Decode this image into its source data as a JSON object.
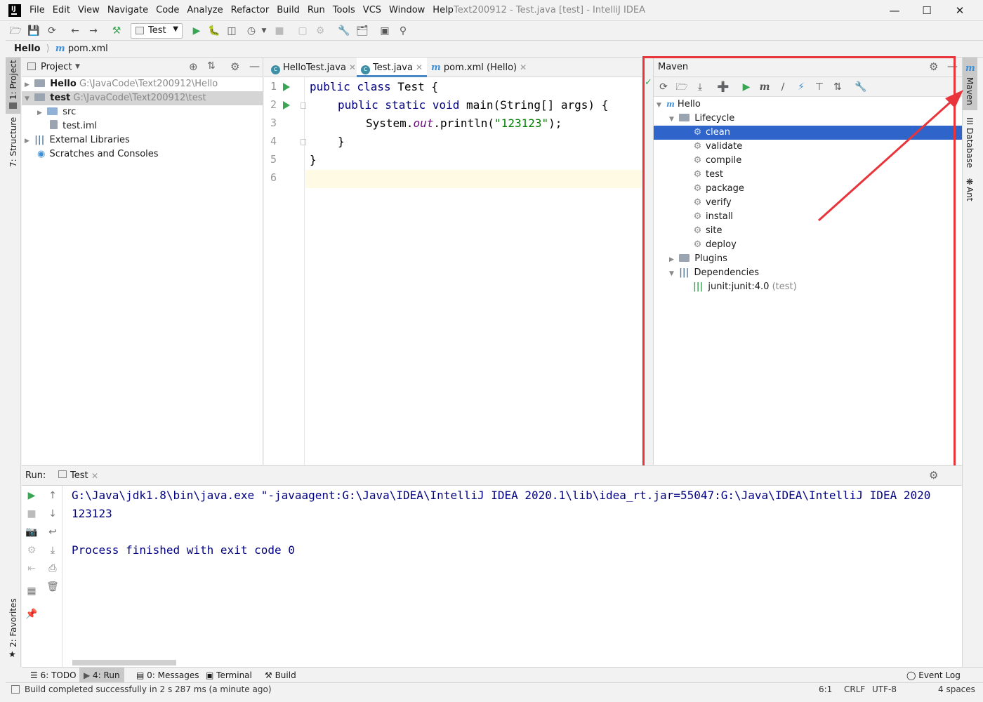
{
  "menu": [
    "File",
    "Edit",
    "View",
    "Navigate",
    "Code",
    "Analyze",
    "Refactor",
    "Build",
    "Run",
    "Tools",
    "VCS",
    "Window",
    "Help"
  ],
  "window_title": "Text200912 - Test.java [test] - IntelliJ IDEA",
  "toolbar": {
    "run_config": "Test"
  },
  "breadcrumb": {
    "project": "Hello",
    "file": "pom.xml"
  },
  "left_stripe": {
    "project": "1: Project",
    "structure": "7: Structure",
    "favorites": "2: Favorites"
  },
  "right_stripe": {
    "maven": "Maven",
    "database": "Database",
    "ant": "Ant"
  },
  "project_panel": {
    "title": "Project",
    "tree": [
      {
        "name": "Hello",
        "path": "G:\\JavaCode\\Text200912\\Hello"
      },
      {
        "name": "test",
        "path": "G:\\JavaCode\\Text200912\\test"
      },
      {
        "name": "src"
      },
      {
        "name": "test.iml"
      },
      {
        "name": "External Libraries"
      },
      {
        "name": "Scratches and Consoles"
      }
    ]
  },
  "editor": {
    "tabs": [
      "HelloTest.java",
      "Test.java",
      "pom.xml (Hello)"
    ],
    "line_numbers": [
      "1",
      "2",
      "3",
      "4",
      "5",
      "6"
    ],
    "code": {
      "l1_kw": "public class ",
      "l1_rest": "Test {",
      "l2_kw": "public static void ",
      "l2_rest": "main(String[] args) {",
      "l3_a": "System.",
      "l3_field": "out",
      "l3_b": ".println(",
      "l3_str": "\"123123\"",
      "l3_c": ");",
      "l4": "}",
      "l5": "}"
    }
  },
  "maven": {
    "title": "Maven",
    "root": "Hello",
    "lifecycle": "Lifecycle",
    "phases": [
      "clean",
      "validate",
      "compile",
      "test",
      "package",
      "verify",
      "install",
      "site",
      "deploy"
    ],
    "selected_phase": "clean",
    "plugins": "Plugins",
    "dependencies": "Dependencies",
    "dependency": "junit:junit:4.0",
    "dependency_scope": "(test)"
  },
  "run_panel": {
    "label": "Run:",
    "tab": "Test",
    "output": [
      "G:\\Java\\jdk1.8\\bin\\java.exe \"-javaagent:G:\\Java\\IDEA\\IntelliJ IDEA 2020.1\\lib\\idea_rt.jar=55047:G:\\Java\\IDEA\\IntelliJ IDEA 2020",
      "123123",
      "",
      "Process finished with exit code 0"
    ]
  },
  "bottom_tabs": {
    "todo": "6: TODO",
    "run": "4: Run",
    "messages": "0: Messages",
    "terminal": "Terminal",
    "build": "Build",
    "event_log": "Event Log"
  },
  "status": {
    "message": "Build completed successfully in 2 s 287 ms (a minute ago)",
    "position": "6:1",
    "line_sep": "CRLF",
    "encoding": "UTF-8",
    "indent": "4 spaces"
  },
  "colors": {
    "selection": "#2f65ca",
    "highlight_box": "#e8343a",
    "run_green": "#3aa655",
    "keyword": "#000080",
    "string": "#008000"
  }
}
